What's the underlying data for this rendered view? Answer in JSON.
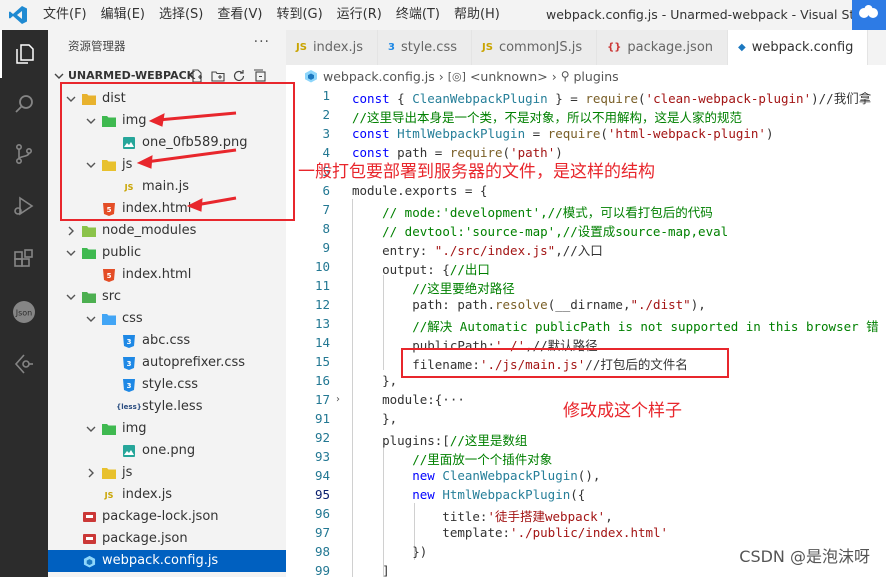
{
  "titlebar": {
    "menu": [
      "文件(F)",
      "编辑(E)",
      "选择(S)",
      "查看(V)",
      "转到(G)",
      "运行(R)",
      "终端(T)",
      "帮助(H)"
    ],
    "window_title": "webpack.config.js - Unarmed-webpack - Visual Studio Co"
  },
  "sidebar": {
    "title": "资源管理器",
    "more": "···",
    "project": "UNARMED-WEBPACK",
    "tree": [
      {
        "label": "dist",
        "type": "folder",
        "open": true
      },
      {
        "label": "img",
        "type": "folder",
        "open": true
      },
      {
        "label": "one_0fb589.png",
        "type": "png"
      },
      {
        "label": "js",
        "type": "folder",
        "open": true
      },
      {
        "label": "main.js",
        "type": "js"
      },
      {
        "label": "index.html",
        "type": "html"
      },
      {
        "label": "node_modules",
        "type": "folder",
        "open": false
      },
      {
        "label": "public",
        "type": "folder",
        "open": true
      },
      {
        "label": "index.html",
        "type": "html"
      },
      {
        "label": "src",
        "type": "folder",
        "open": true
      },
      {
        "label": "css",
        "type": "folder",
        "open": true
      },
      {
        "label": "abc.css",
        "type": "css"
      },
      {
        "label": "autoprefixer.css",
        "type": "css"
      },
      {
        "label": "style.css",
        "type": "css"
      },
      {
        "label": "style.less",
        "type": "less"
      },
      {
        "label": "img",
        "type": "folder",
        "open": true
      },
      {
        "label": "one.png",
        "type": "png"
      },
      {
        "label": "js",
        "type": "folder",
        "open": false
      },
      {
        "label": "index.js",
        "type": "js"
      },
      {
        "label": "package-lock.json",
        "type": "json"
      },
      {
        "label": "package.json",
        "type": "json"
      },
      {
        "label": "webpack.config.js",
        "type": "webpack",
        "selected": true
      }
    ]
  },
  "tabs": [
    {
      "label": "index.js",
      "icon": "JS"
    },
    {
      "label": "style.css",
      "icon": "CSS"
    },
    {
      "label": "commonJS.js",
      "icon": "JS"
    },
    {
      "label": "package.json",
      "icon": "{}"
    },
    {
      "label": "webpack.config",
      "icon": "WP",
      "active": true
    }
  ],
  "breadcrumb": {
    "file": "webpack.config.js",
    "symbol": "<unknown>",
    "leaf": "plugins"
  },
  "code": {
    "line_numbers": [
      "1",
      "2",
      "3",
      "4",
      "5",
      "6",
      "7",
      "8",
      "9",
      "10",
      "11",
      "12",
      "13",
      "14",
      "15",
      "16",
      "17",
      "91",
      "92",
      "93",
      "94",
      "95",
      "96",
      "97",
      "98",
      "99"
    ],
    "lines": [
      "const { CleanWebpackPlugin } = require('clean-webpack-plugin')//我们拿",
      "//这里导出本身是一个类，不是对象，所以不用解构，这是人家的规范",
      "const HtmlWebpackPlugin = require('html-webpack-plugin')",
      "const path = require('path')",
      "",
      "module.exports = {",
      "    // mode:'development',//模式，可以看打包后的代码",
      "    // devtool:'source-map',//设置成source-map,eval",
      "    entry: \"./src/index.js\",//入口",
      "    output: {//出口",
      "        //这里要绝对路径",
      "        path: path.resolve(__dirname,\"./dist\"),",
      "        //解决 Automatic publicPath is not supported in this browser 错",
      "        publicPath:'./',//默认路径",
      "        filename:'./js/main.js'//打包后的文件名",
      "    },",
      "    module:{···",
      "    },",
      "    plugins:[//这里是数组",
      "        //里面放一个个插件对象",
      "        new CleanWebpackPlugin(),",
      "        new HtmlWebpackPlugin({",
      "            title:'徒手搭建webpack',",
      "            template:'./public/index.html'",
      "        })",
      "    ]"
    ]
  },
  "annotations": {
    "structure_note": "一般打包要部署到服务器的文件，是这样的结构",
    "modify_note": "修改成这个样子"
  },
  "watermark": "CSDN @是泡沫呀",
  "colors": {
    "annotation": "#e8262c",
    "selection": "#0060c0",
    "activity_bar": "#2c2c2c"
  }
}
